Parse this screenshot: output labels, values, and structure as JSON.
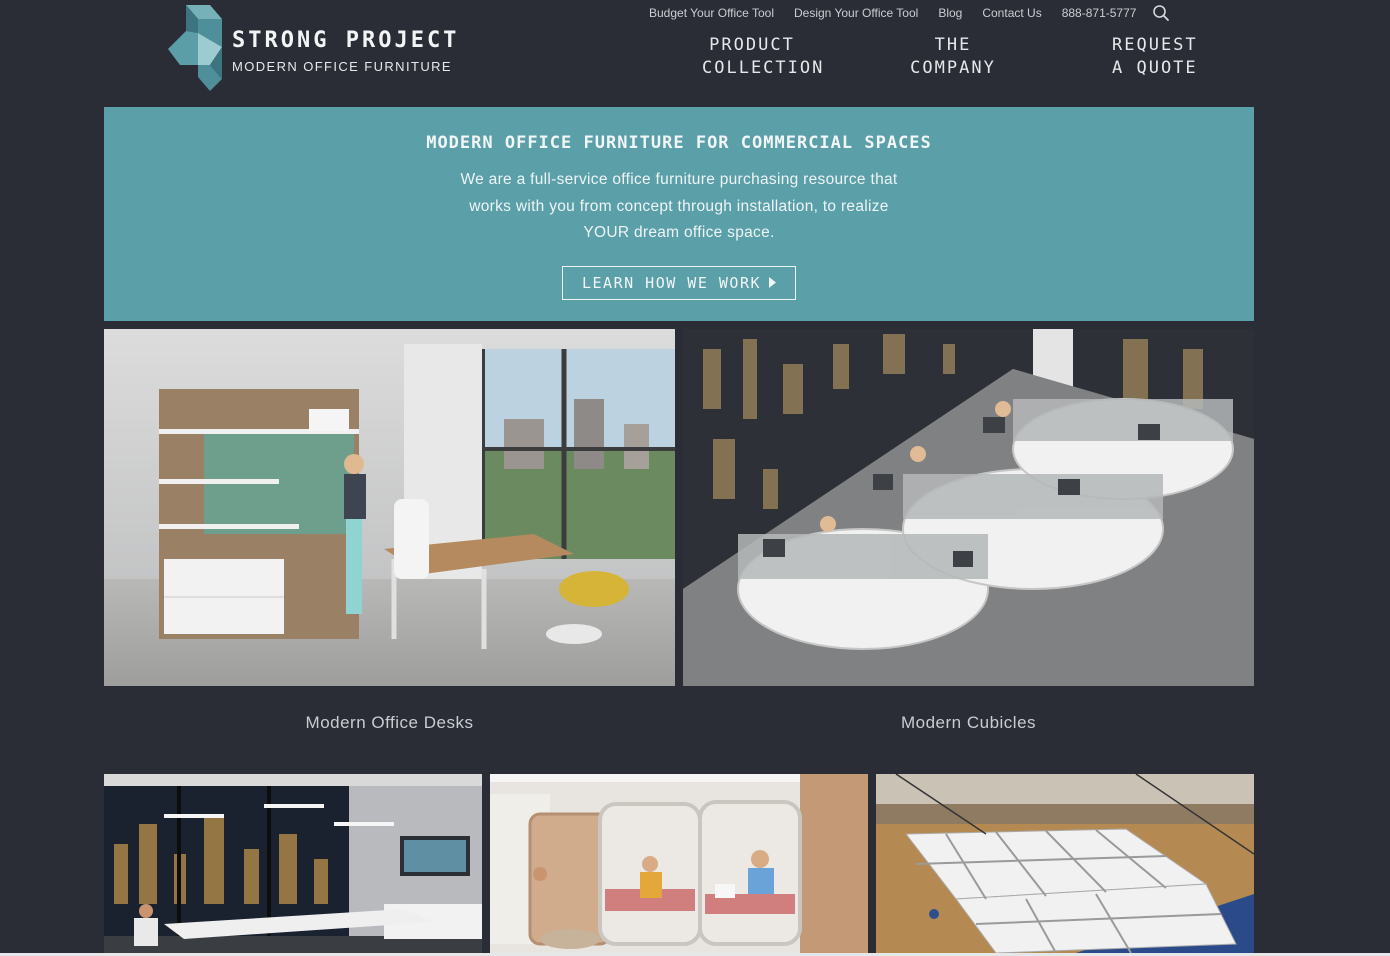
{
  "utility_nav": {
    "budget_tool": "Budget Your Office Tool",
    "design_tool": "Design Your Office Tool",
    "blog": "Blog",
    "contact": "Contact Us",
    "phone": "888-871-5777",
    "search_icon": "search-icon"
  },
  "logo": {
    "title": "STRONG PROJECT",
    "subtitle": "MODERN OFFICE FURNITURE",
    "mark_colors": [
      "#4f8f99",
      "#76b0b8",
      "#3c7580",
      "#9ccbd1"
    ]
  },
  "main_nav": {
    "product_line1": "PRODUCT",
    "product_line2": "COLLECTION",
    "company_line1": "THE",
    "company_line2": "COMPANY",
    "quote_line1": "REQUEST",
    "quote_line2": "A QUOTE"
  },
  "hero": {
    "title": "MODERN OFFICE FURNITURE FOR COMMERCIAL SPACES",
    "text": "We are a full-service office furniture purchasing resource that works with you from concept through installation, to realize YOUR dream office space.",
    "button_label": "LEARN HOW WE WORK",
    "button_icon": "caret-right-icon",
    "background": "#5b9fa9"
  },
  "categories": [
    {
      "caption": "Modern Office Desks",
      "image": "office-desk-photo"
    },
    {
      "caption": "Modern Cubicles",
      "image": "cubicles-photo"
    }
  ],
  "bottom_tiles": [
    {
      "image": "conference-room-photo"
    },
    {
      "image": "lounge-pods-photo"
    },
    {
      "image": "gym-cubicle-install-photo"
    }
  ],
  "colors": {
    "page_bg": "#2a2d35",
    "accent_teal": "#5b9fa9"
  }
}
